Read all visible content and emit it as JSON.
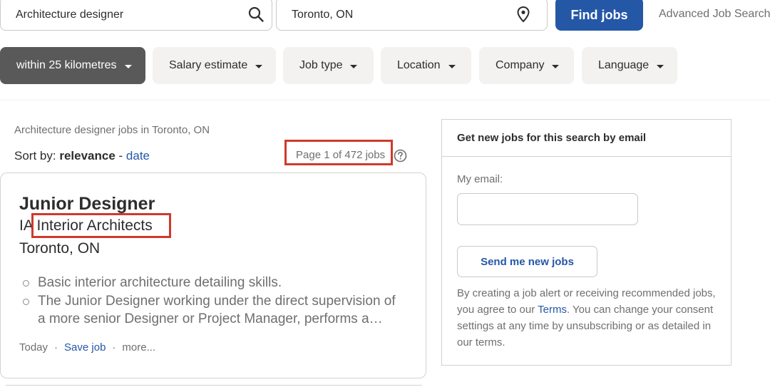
{
  "search": {
    "what_value": "Architecture designer",
    "where_value": "Toronto, ON",
    "find_label": "Find jobs",
    "advanced_label": "Advanced Job Search"
  },
  "filters": [
    {
      "label": "within 25 kilometres",
      "active": true
    },
    {
      "label": "Salary estimate",
      "active": false
    },
    {
      "label": "Job type",
      "active": false
    },
    {
      "label": "Location",
      "active": false
    },
    {
      "label": "Company",
      "active": false
    },
    {
      "label": "Language",
      "active": false
    }
  ],
  "results": {
    "breadcrumb": "Architecture designer jobs in Toronto, ON",
    "sort_prefix": "Sort by:",
    "sort_active": "relevance",
    "sort_separator": "-",
    "sort_alt": "date",
    "page_count": "Page 1 of 472 jobs"
  },
  "job": {
    "title": "Junior Designer",
    "company_prefix": "IA",
    "company_name": "Interior Architects",
    "location": "Toronto, ON",
    "snippets": [
      "Basic interior architecture detailing skills.",
      "The Junior Designer working under the direct supervision of a more senior Designer or Project Manager, performs a…"
    ],
    "posted": "Today",
    "dot": "·",
    "save_label": "Save job",
    "more_label": "more..."
  },
  "alert": {
    "header": "Get new jobs for this search by email",
    "email_label": "My email:",
    "email_value": "",
    "button_label": "Send me new jobs",
    "legal_before": "By creating a job alert or receiving recommended jobs, you agree to our ",
    "legal_link": "Terms",
    "legal_after": ". You can change your consent settings at any time by unsubscribing or as detailed in our terms."
  },
  "colors": {
    "brand_blue": "#2557a7",
    "highlight_red": "#d0392b",
    "active_chip": "#595959"
  },
  "icons": {
    "what": "search-icon",
    "where": "location-pin-icon",
    "help": "help-circle-icon",
    "chip": "caret-down-icon"
  }
}
